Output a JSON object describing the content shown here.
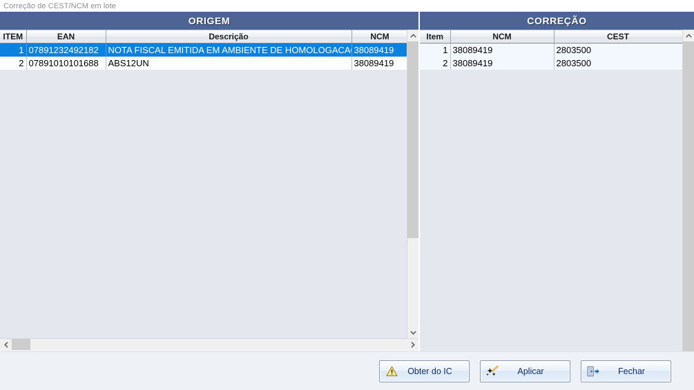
{
  "window": {
    "title": "Correção de CEST/NCM em lote"
  },
  "colors": {
    "panel_header_bg": "#4d6494",
    "selection_blue": "#0b82e0",
    "grid_empty_bg": "#e4e8ee",
    "button_text": "#13306b",
    "warning_yellow": "#f2c40d"
  },
  "origem": {
    "header": "ORIGEM",
    "columns": [
      "ITEM",
      "EAN",
      "Descrição",
      "NCM"
    ],
    "rows": [
      {
        "item": "1",
        "ean": "07891232492182",
        "descricao": "NOTA FISCAL EMITIDA EM AMBIENTE DE HOMOLOGACAO",
        "ncm": "38089419",
        "selected": true
      },
      {
        "item": "2",
        "ean": "07891010101688",
        "descricao": "ABS12UN",
        "ncm": "38089419",
        "selected": false
      }
    ],
    "vscroll": {
      "up_icon": "chevron-up",
      "down_icon": "chevron-down"
    },
    "hscroll": {
      "left_icon": "chevron-left",
      "right_icon": "chevron-right"
    }
  },
  "correcao": {
    "header": "CORREÇÃO",
    "columns": [
      "Item",
      "NCM",
      "CEST"
    ],
    "rows": [
      {
        "item": "1",
        "ncm": "38089419",
        "cest": "2803500"
      },
      {
        "item": "2",
        "ncm": "38089419",
        "cest": "2803500"
      }
    ],
    "vscroll": {
      "up_icon": "chevron-up"
    }
  },
  "footer": {
    "buttons": [
      {
        "label": "Obter do IC",
        "icon": "warning-triangle-icon"
      },
      {
        "label": "Aplicar",
        "icon": "magic-wand-icon"
      },
      {
        "label": "Fechar",
        "icon": "exit-door-icon"
      }
    ]
  }
}
